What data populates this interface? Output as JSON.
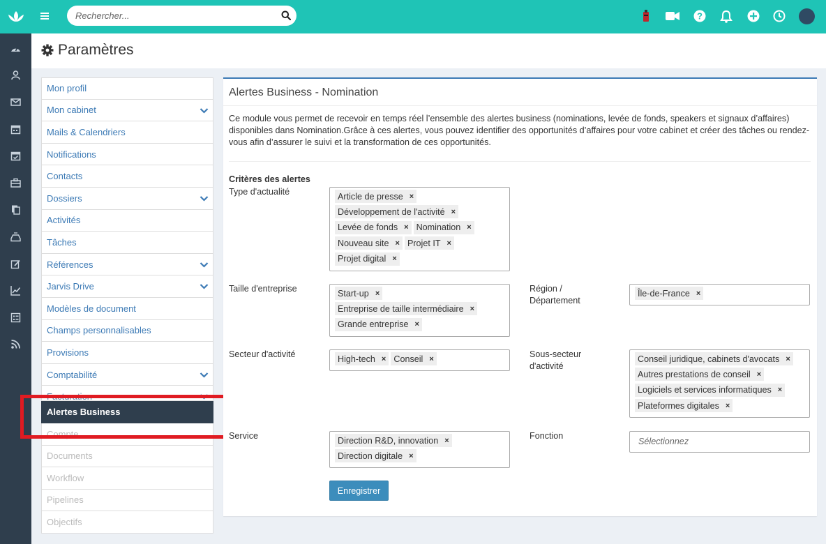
{
  "search": {
    "placeholder": "Rechercher..."
  },
  "page": {
    "title": "Paramètres"
  },
  "rail": {
    "icons": [
      "dashboard-icon",
      "contacts-icon",
      "mail-icon",
      "calendar-icon",
      "calendar-check-icon",
      "briefcase-icon",
      "documents-icon",
      "tray-icon",
      "edit-icon",
      "chart-icon",
      "list-icon",
      "rss-icon"
    ]
  },
  "topbar": {
    "icons": [
      "extension-icon",
      "video-icon",
      "help-icon",
      "bell-icon",
      "plus-circle-icon",
      "clock-icon"
    ]
  },
  "menu": {
    "items": [
      {
        "label": "Mon profil",
        "chevron": false
      },
      {
        "label": "Mon cabinet",
        "chevron": true
      },
      {
        "label": "Mails & Calendriers",
        "chevron": false
      },
      {
        "label": "Notifications",
        "chevron": false
      },
      {
        "label": "Contacts",
        "chevron": false
      },
      {
        "label": "Dossiers",
        "chevron": true
      },
      {
        "label": "Activités",
        "chevron": false
      },
      {
        "label": "Tâches",
        "chevron": false
      },
      {
        "label": "Références",
        "chevron": true
      },
      {
        "label": "Jarvis Drive",
        "chevron": true
      },
      {
        "label": "Modèles de document",
        "chevron": false
      },
      {
        "label": "Champs personnalisables",
        "chevron": false
      },
      {
        "label": "Provisions",
        "chevron": false
      },
      {
        "label": "Comptabilité",
        "chevron": true
      },
      {
        "label": "Facturation",
        "chevron": true
      },
      {
        "label": "Alertes Business",
        "chevron": false
      },
      {
        "label": "Compte",
        "chevron": false
      },
      {
        "label": "Documents",
        "chevron": false
      },
      {
        "label": "Workflow",
        "chevron": false
      },
      {
        "label": "Pipelines",
        "chevron": false
      },
      {
        "label": "Objectifs",
        "chevron": false
      }
    ]
  },
  "panel": {
    "title": "Alertes Business - Nomination",
    "description": "Ce module vous permet de recevoir en temps réel l’ensemble des alertes business (nominations, levée de fonds, speakers et signaux d’affaires) disponibles dans Nomination.Grâce à ces alertes, vous pouvez identifier des opportunités d’affaires pour votre cabinet et créer des tâches ou rendez-vous afin d’assurer le suivi et la transformation de ces opportunités.",
    "criteria_title": "Critères des alertes",
    "fields": {
      "type": {
        "label": "Type d'actualité",
        "tags": [
          "Article de presse",
          "Développement de l'activité",
          "Levée de fonds",
          "Nomination",
          "Nouveau site",
          "Projet IT",
          "Projet digital"
        ]
      },
      "taille": {
        "label": "Taille d'entreprise",
        "tags": [
          "Start-up",
          "Entreprise de taille intermédiaire",
          "Grande entreprise"
        ]
      },
      "region": {
        "label": "Région / Département",
        "tags": [
          "Île-de-France"
        ]
      },
      "secteur": {
        "label": "Secteur d'activité",
        "tags": [
          "High-tech",
          "Conseil"
        ]
      },
      "sous_secteur": {
        "label": "Sous-secteur d'activité",
        "tags": [
          "Conseil juridique, cabinets d'avocats",
          "Autres prestations de conseil",
          "Logiciels et services informatiques",
          "Plateformes digitales"
        ]
      },
      "service": {
        "label": "Service",
        "tags": [
          "Direction R&D, innovation",
          "Direction digitale"
        ]
      },
      "fonction": {
        "label": "Fonction",
        "placeholder": "Sélectionnez",
        "tags": []
      }
    },
    "save_label": "Enregistrer",
    "remove_symbol": "×"
  },
  "colors": {
    "teal": "#1fc4b6",
    "rail": "#2f3e4d",
    "link": "#3c7ab5",
    "button": "#3c8dbc",
    "highlight": "#e01b22"
  }
}
